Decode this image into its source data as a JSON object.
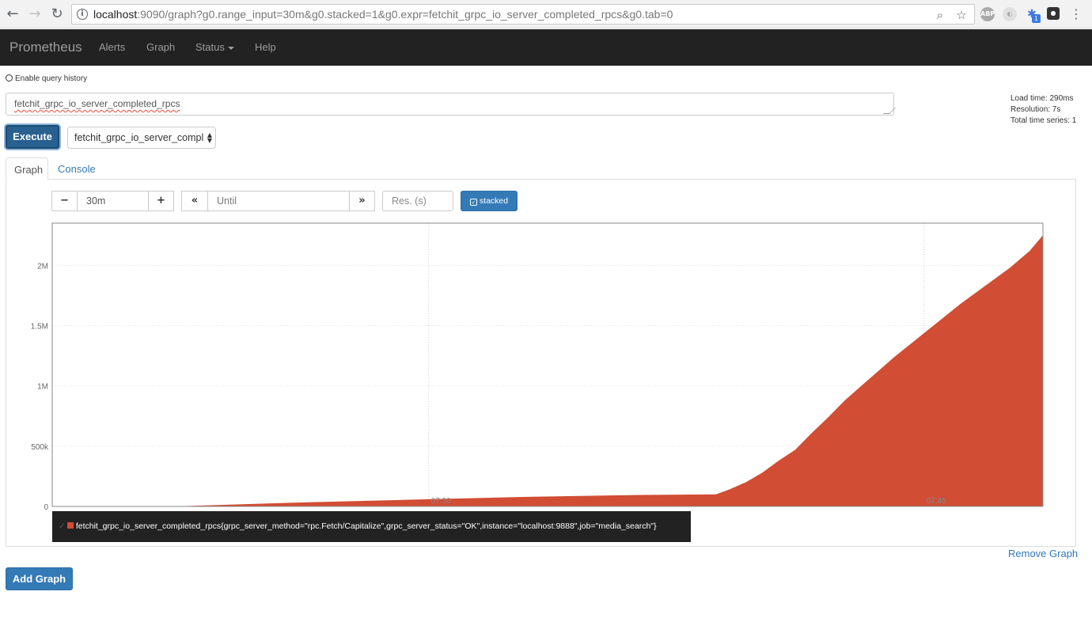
{
  "browser": {
    "url_host": "localhost",
    "url_rest": ":9090/graph?g0.range_input=30m&g0.stacked=1&g0.expr=fetchit_grpc_io_server_completed_rpcs&g0.tab=0",
    "abp_label": "ABP",
    "ext_badge": "1"
  },
  "navbar": {
    "brand": "Prometheus",
    "links": [
      "Alerts",
      "Graph",
      "Status",
      "Help"
    ]
  },
  "query": {
    "history_label": "Enable query history",
    "expression": "fetchit_grpc_io_server_completed_rpcs",
    "execute_label": "Execute",
    "metric_select_value": "fetchit_grpc_io_server_compl"
  },
  "stats": {
    "load_time": "Load time: 290ms",
    "resolution": "Resolution: 7s",
    "total_series": "Total time series: 1"
  },
  "tabs": {
    "graph": "Graph",
    "console": "Console"
  },
  "controls": {
    "minus": "−",
    "range_value": "30m",
    "plus": "+",
    "back": "«",
    "until_placeholder": "Until",
    "forward": "»",
    "res_placeholder": "Res. (s)",
    "stacked_label": "stacked"
  },
  "legend": {
    "series": "fetchit_grpc_io_server_completed_rpcs{grpc_server_method=\"rpc.Fetch/Capitalize\",grpc_server_status=\"OK\",instance=\"localhost:9888\",job=\"media_search\"}"
  },
  "actions": {
    "remove_graph": "Remove Graph",
    "add_graph": "Add Graph"
  },
  "chart_data": {
    "type": "area",
    "x_unit": "minutes since 07:15",
    "xlim": [
      0,
      30
    ],
    "ylim": [
      0,
      2350000
    ],
    "yticks": [
      0,
      500000,
      1000000,
      1500000,
      2000000
    ],
    "ytick_labels": [
      "0",
      "500k",
      "1M",
      "1.5M",
      "2M"
    ],
    "xticks": [
      11.4,
      26.4
    ],
    "xtick_labels": [
      "07:30",
      "07:45"
    ],
    "color": "#d14d34",
    "grid": true,
    "series": [
      {
        "name": "fetchit_grpc_io_server_completed_rpcs",
        "x": [
          0,
          3.6,
          7.2,
          11.4,
          14.4,
          17.8,
          20.1,
          20.5,
          21.0,
          21.5,
          22.0,
          22.5,
          23.0,
          23.5,
          24.0,
          24.5,
          25.0,
          25.5,
          26.0,
          26.5,
          27.0,
          27.5,
          28.0,
          28.5,
          29.0,
          29.6,
          30.0
        ],
        "y": [
          0,
          0,
          30000,
          60000,
          80000,
          95000,
          100000,
          140000,
          200000,
          280000,
          380000,
          470000,
          610000,
          740000,
          880000,
          1000000,
          1120000,
          1240000,
          1350000,
          1460000,
          1570000,
          1680000,
          1780000,
          1880000,
          1980000,
          2120000,
          2250000
        ]
      }
    ]
  }
}
